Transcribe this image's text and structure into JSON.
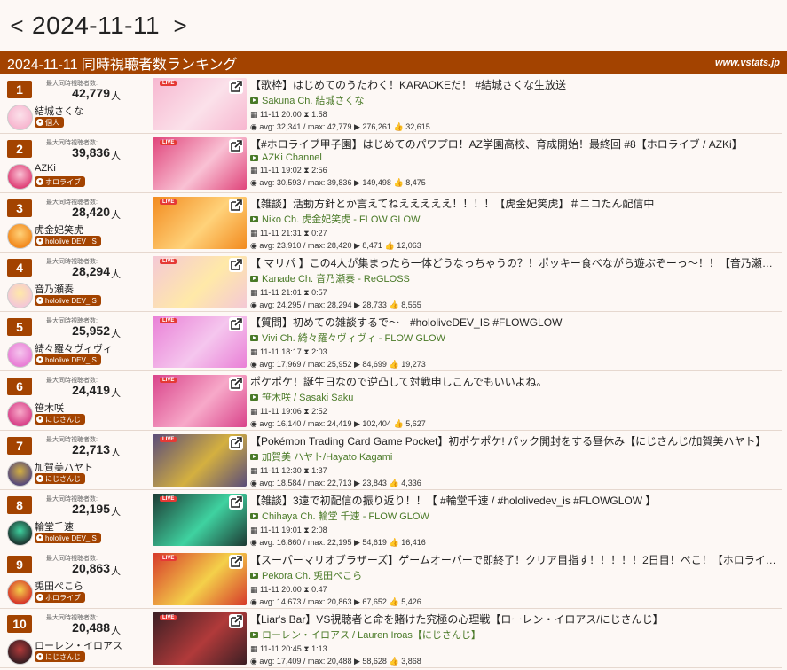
{
  "nav": {
    "prev": "<",
    "date": "2024-11-11",
    "next": ">"
  },
  "header": {
    "title": "2024-11-11 同時視聴者数ランキング",
    "site": "www.vstats.jp"
  },
  "labels": {
    "max_label": "最大同時視聴者数:",
    "unit": "人",
    "live": "LIVE"
  },
  "rows": [
    {
      "rank": "1",
      "max": "42,779",
      "name": "結城さくな",
      "badge": "個人",
      "title": "【歌枠】はじめてのうたわく！KARAOKEだ！ #結城さくな生放送",
      "channel": "Sakuna Ch. 結城さくな",
      "time": "11-11 20:00",
      "dur": "1:58",
      "avg": "avg: 32,341 / max: 42,779",
      "views": "276,261",
      "likes": "32,615",
      "thumb": "#f7b7d0",
      "accent": "#fbe1ea"
    },
    {
      "rank": "2",
      "max": "39,836",
      "name": "AZKi",
      "badge": "ホロライブ",
      "title": "【#ホロライブ甲子園】はじめてのパワプロ！AZ学園高校、育成開始！最終回 #8【ホロライブ / AZKi】",
      "channel": "AZKi Channel",
      "time": "11-11 19:02",
      "dur": "2:56",
      "avg": "avg: 30,593 / max: 39,836",
      "views": "149,498",
      "likes": "8,475",
      "thumb": "#e0447a",
      "accent": "#f9c1d4"
    },
    {
      "rank": "3",
      "max": "28,420",
      "name": "虎金妃笑虎",
      "badge": "hololive DEV_IS",
      "title": "【雑談】活動方針とか言えてねえええええ！！！！【虎金妃笑虎】＃ニコたん配信中",
      "channel": "Niko Ch. 虎金妃笑虎 - FLOW GLOW",
      "time": "11-11 21:31",
      "dur": "0:27",
      "avg": "avg: 23,910 / max: 28,420",
      "views": "8,471",
      "likes": "12,063",
      "thumb": "#f28a1e",
      "accent": "#ffd27a"
    },
    {
      "rank": "4",
      "max": "28,294",
      "name": "音乃瀬奏",
      "badge": "hololive DEV_IS",
      "title": "【 マリパ 】この4人が集まったら一体どうなっちゃうの？！ポッキー食べながら遊ぶぞーっ～！！【音乃瀬…",
      "channel": "Kanade Ch. 音乃瀬奏 - ReGLOSS",
      "time": "11-11 21:01",
      "dur": "0:57",
      "avg": "avg: 24,295 / max: 28,294",
      "views": "28,733",
      "likes": "8,555",
      "thumb": "#f4c8d6",
      "accent": "#ffe9a8"
    },
    {
      "rank": "5",
      "max": "25,952",
      "name": "綺々羅々ヴィヴィ",
      "badge": "hololive DEV_IS",
      "title": "【質問】初めての雑談するで～　#hololiveDEV_IS #FLOWGLOW",
      "channel": "Vivi Ch. 綺々羅々ヴィヴィ - FLOW GLOW",
      "time": "11-11 18:17",
      "dur": "2:03",
      "avg": "avg: 17,969 / max: 25,952",
      "views": "84,699",
      "likes": "19,273",
      "thumb": "#e97fd6",
      "accent": "#f5c6ee"
    },
    {
      "rank": "6",
      "max": "24,419",
      "name": "笹木咲",
      "badge": "にじさんじ",
      "title": "ポケポケ！誕生日なので逆凸して対戦申しこんでもいいよね。",
      "channel": "笹木咲 / Sasaki Saku",
      "time": "11-11 19:06",
      "dur": "2:52",
      "avg": "avg: 16,140 / max: 24,419",
      "views": "102,404",
      "likes": "5,627",
      "thumb": "#d9438a",
      "accent": "#f7a9c9"
    },
    {
      "rank": "7",
      "max": "22,713",
      "name": "加賀美ハヤト",
      "badge": "にじさんじ",
      "title": "【Pokémon Trading Card Game Pocket】初ポケポケ! パック開封をする昼休み【にじさんじ/加賀美ハヤト】",
      "channel": "加賀美 ハヤト/Hayato Kagami",
      "time": "11-11 12:30",
      "dur": "1:37",
      "avg": "avg: 18,584 / max: 22,713",
      "views": "23,843",
      "likes": "4,336",
      "thumb": "#5a4c7a",
      "accent": "#d4b040"
    },
    {
      "rank": "8",
      "max": "22,195",
      "name": "輪堂千速",
      "badge": "hololive DEV_IS",
      "title": "【雑談】3遠で初配信の振り返り！！【 #輪堂千速 / #hololivedev_is #FLOWGLOW 】",
      "channel": "Chihaya Ch. 輪堂 千速 - FLOW GLOW",
      "time": "11-11 19:01",
      "dur": "2:08",
      "avg": "avg: 16,860 / max: 22,195",
      "views": "54,619",
      "likes": "16,416",
      "thumb": "#1d3a33",
      "accent": "#3fd2a0"
    },
    {
      "rank": "9",
      "max": "20,863",
      "name": "兎田ぺこら",
      "badge": "ホロライブ",
      "title": "【スーパーマリオブラザーズ】ゲームオーバーで即終了！クリア目指す！！！！！2日目！ぺこ！【ホロライ…",
      "channel": "Pekora Ch. 兎田ぺこら",
      "time": "11-11 20:00",
      "dur": "0:47",
      "avg": "avg: 14,673 / max: 20,863",
      "views": "67,652",
      "likes": "5,426",
      "thumb": "#d6392a",
      "accent": "#f4d04a"
    },
    {
      "rank": "10",
      "max": "20,488",
      "name": "ローレン・イロアス",
      "badge": "にじさんじ",
      "title": "【Liar's Bar】VS視聴者と命を賭けた究極の心理戦【ローレン・イロアス/にじさんじ】",
      "channel": "ローレン・イロアス / Lauren Iroas【にじさんじ】",
      "time": "11-11 20:45",
      "dur": "1:13",
      "avg": "avg: 17,409 / max: 20,488",
      "views": "58,628",
      "likes": "3,868",
      "thumb": "#3b1f24",
      "accent": "#b13a3a"
    }
  ]
}
